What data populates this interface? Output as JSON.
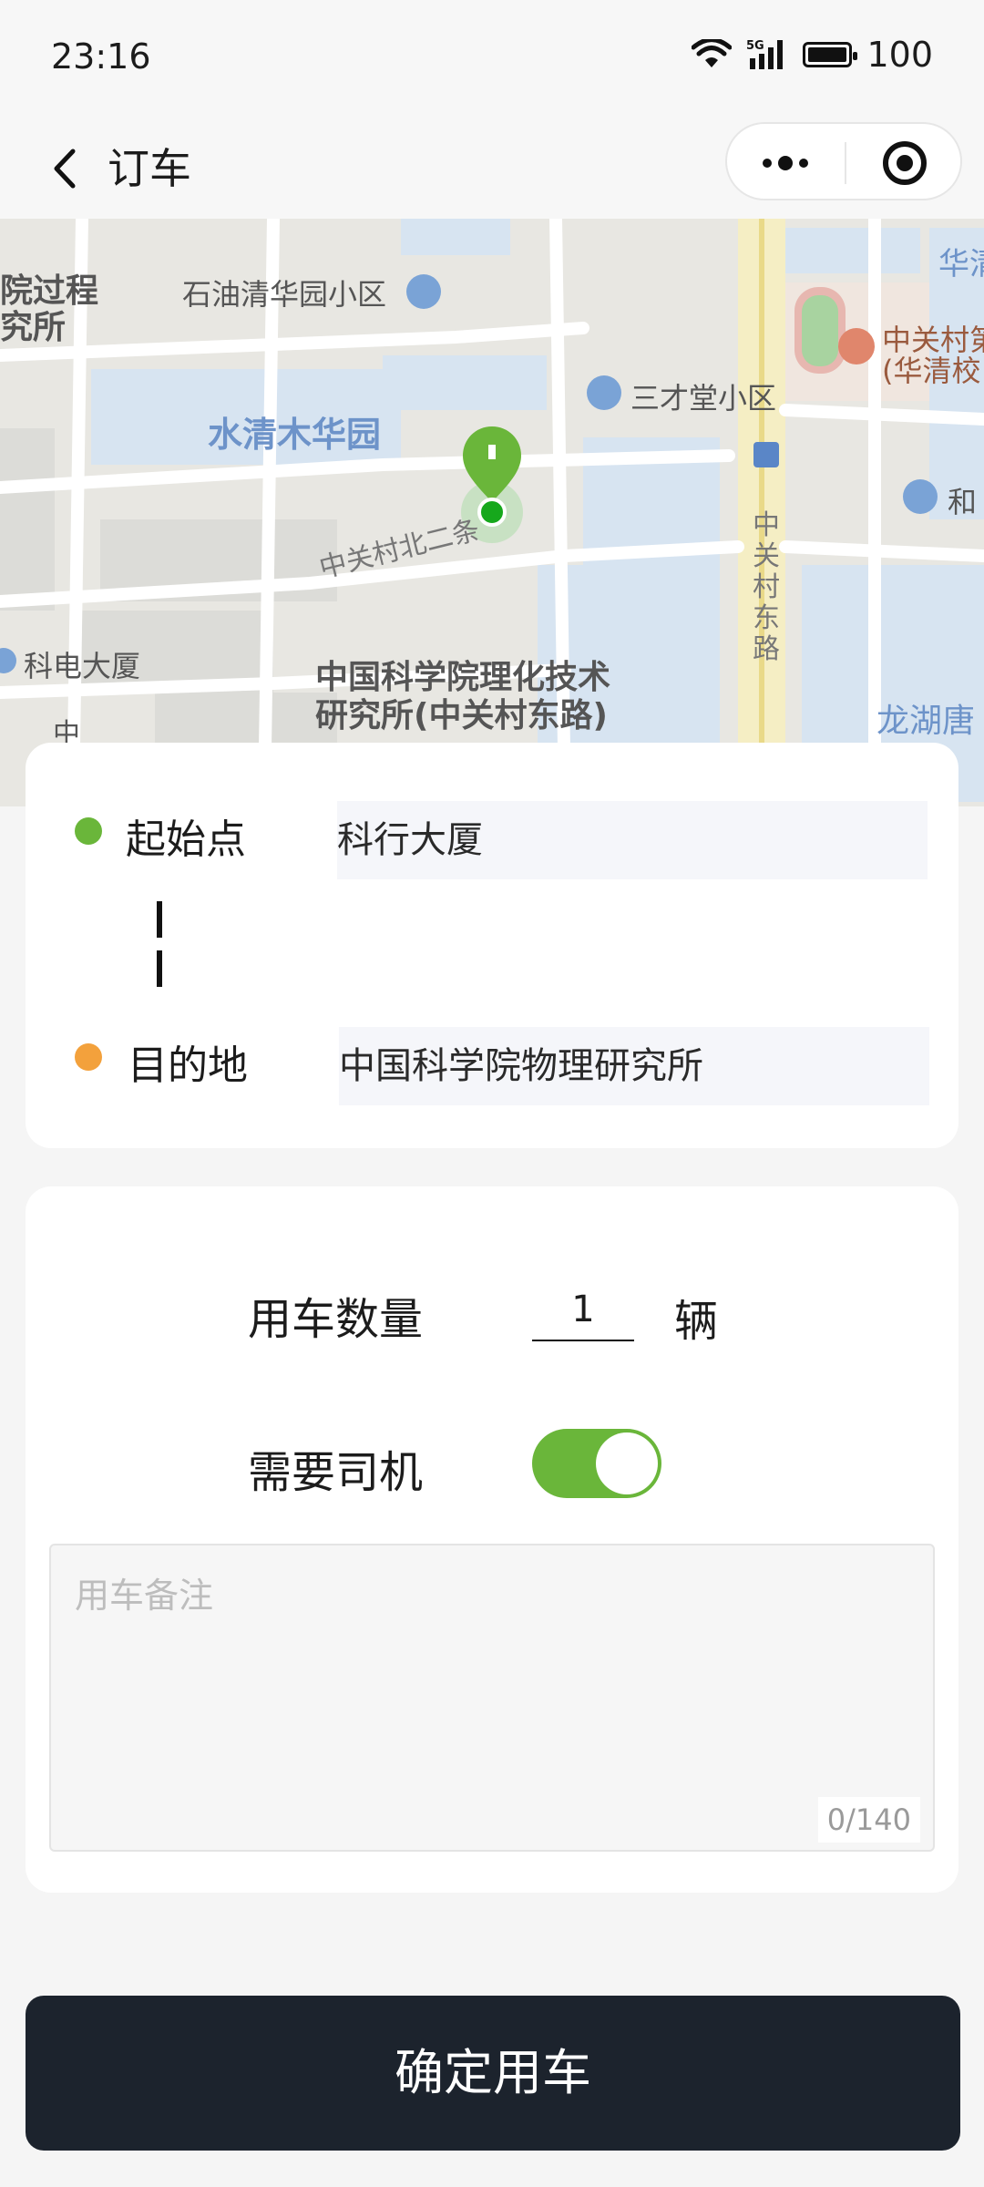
{
  "status_bar": {
    "time": "23:16",
    "network": "5G",
    "battery": "100",
    "icons": [
      "wifi-icon",
      "signal-5g-icon",
      "battery-icon"
    ]
  },
  "nav": {
    "back_icon": "chevron-left-icon",
    "title": "订车",
    "capsule": {
      "more_icon": "more-dots-icon",
      "close_icon": "target-circle-icon"
    }
  },
  "map": {
    "labels": {
      "l1": "院过程",
      "l2": "究所",
      "l3": "石油清华园小区",
      "l4": "华清",
      "l5": "中关村第",
      "l6": "(华清校",
      "l7": "三才堂小区",
      "l8": "水清木华园",
      "l9": "和",
      "l10": "中关村北二条",
      "l11": "中关村东路",
      "l12": "科电大厦",
      "l13": "中国科学院理化技术",
      "l14": "研究所(中关村东路)",
      "l15": "龙湖唐",
      "l16": "中"
    },
    "marker_icon": "location-pin-icon"
  },
  "route": {
    "start_label": "起始点",
    "start_value": "科行大厦",
    "end_label": "目的地",
    "end_value": "中国科学院物理研究所",
    "start_dot_color": "#6ab63a",
    "end_dot_color": "#f3a13c"
  },
  "options": {
    "quantity_label": "用车数量",
    "quantity_value": "1",
    "quantity_unit": "辆",
    "driver_label": "需要司机",
    "driver_on": true,
    "toggle_color": "#6ab63a",
    "remark_placeholder": "用车备注",
    "remark_count": "0/140"
  },
  "confirm_label": "确定用车"
}
